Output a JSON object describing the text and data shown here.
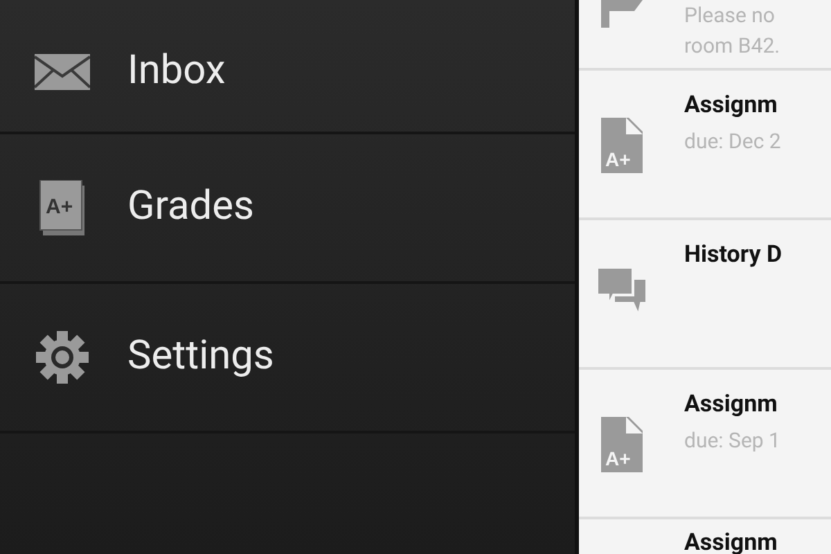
{
  "drawer": {
    "items": [
      {
        "kind": "inbox",
        "label": "Inbox"
      },
      {
        "kind": "grades",
        "label": "Grades",
        "badge": "A+"
      },
      {
        "kind": "settings",
        "label": "Settings"
      }
    ]
  },
  "feed": {
    "items": [
      {
        "kind": "announcement",
        "lines": [
          "Please no",
          "room B42."
        ]
      },
      {
        "kind": "assignment",
        "badge": "A+",
        "title": "Assignm",
        "lines": [
          "due: Dec 2"
        ]
      },
      {
        "kind": "discussion",
        "title": "History D"
      },
      {
        "kind": "assignment",
        "badge": "A+",
        "title": "Assignm",
        "lines": [
          "due: Sep 1"
        ]
      },
      {
        "kind": "assignment",
        "title": "Assignm"
      }
    ]
  }
}
